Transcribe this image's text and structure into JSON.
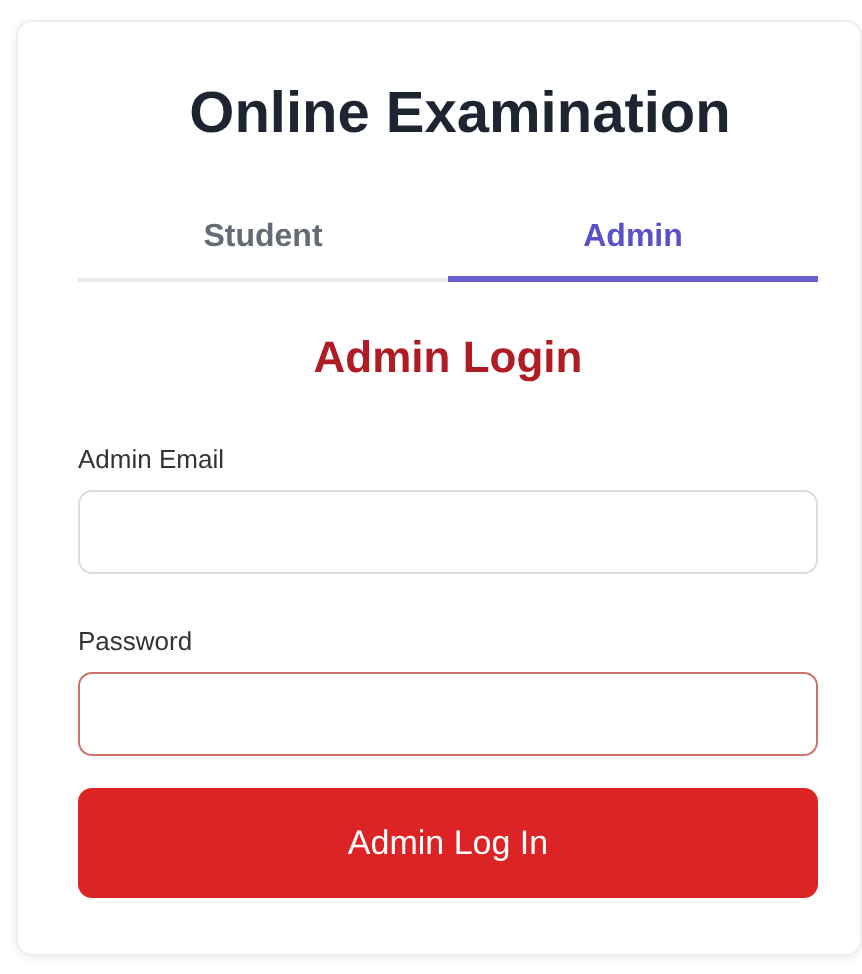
{
  "title": "Online Examination",
  "tabs": [
    {
      "label": "Student",
      "selected": false
    },
    {
      "label": "Admin",
      "selected": true
    }
  ],
  "heading": "Admin Login",
  "fields": [
    {
      "label": "Admin Email",
      "focused": false
    },
    {
      "label": "Password",
      "focused": true
    }
  ],
  "submit_button": "Admin Log In"
}
